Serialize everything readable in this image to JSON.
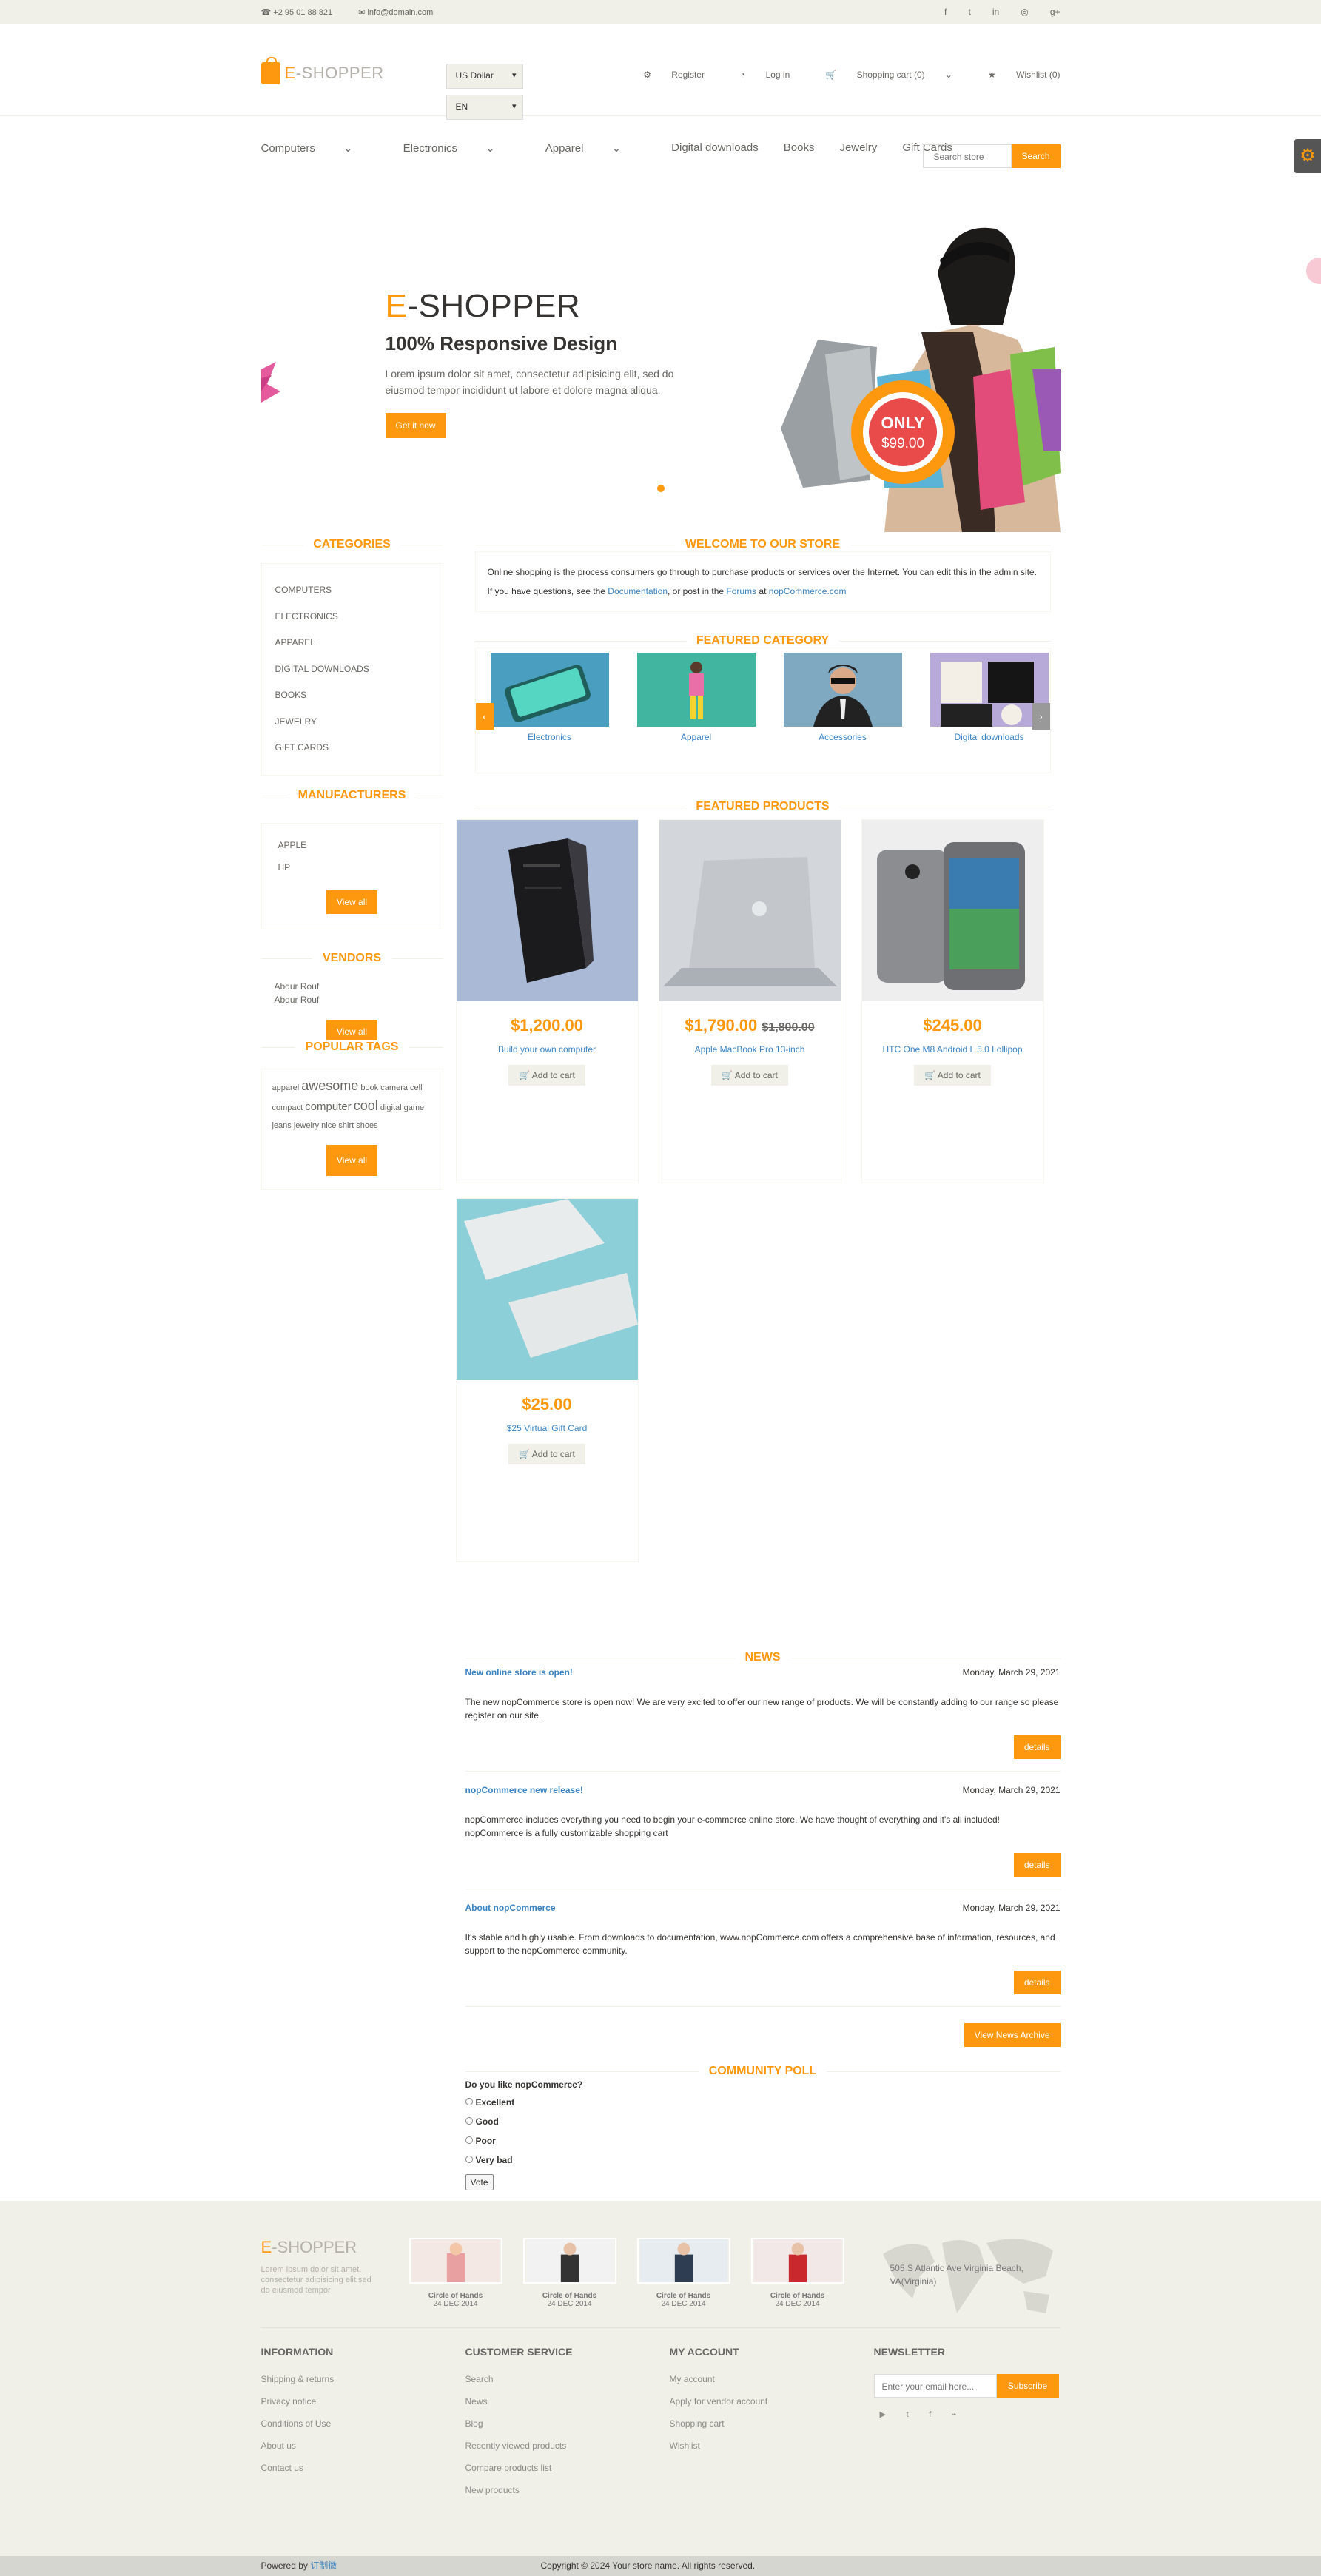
{
  "topbar": {
    "phone": "+2 95 01 88 821",
    "email": "info@domain.com"
  },
  "social_icons": [
    "facebook-icon",
    "twitter-icon",
    "linkedin-icon",
    "dribbble-icon",
    "google-plus-icon"
  ],
  "header": {
    "logo_e": "E",
    "logo_rest": "-SHOPPER",
    "currency": "US Dollar",
    "language": "EN",
    "register": "Register",
    "login": "Log in",
    "cart": "Shopping cart (0)",
    "wishlist": "Wishlist (0)"
  },
  "menu": {
    "items": [
      {
        "label": "Computers",
        "has_dropdown": true
      },
      {
        "label": "Electronics",
        "has_dropdown": true
      },
      {
        "label": "Apparel",
        "has_dropdown": true
      },
      {
        "label": "Digital downloads",
        "has_dropdown": false
      },
      {
        "label": "Books",
        "has_dropdown": false
      },
      {
        "label": "Jewelry",
        "has_dropdown": false
      },
      {
        "label": "Gift Cards",
        "has_dropdown": false
      }
    ],
    "search_placeholder": "Search store",
    "search_button": "Search"
  },
  "slider": {
    "title_e": "E",
    "title_rest": "-SHOPPER",
    "subtitle": "100% Responsive Design",
    "text": "Lorem ipsum dolor sit amet, consectetur adipisicing elit, sed do eiusmod tempor incididunt ut labore et dolore magna aliqua.",
    "button": "Get it now",
    "badge_top": "ONLY",
    "badge_price": "$99.00"
  },
  "sidebar": {
    "categories_title": "CATEGORIES",
    "categories": [
      "COMPUTERS",
      "ELECTRONICS",
      "APPAREL",
      "DIGITAL DOWNLOADS",
      "BOOKS",
      "JEWELRY",
      "GIFT CARDS"
    ],
    "manufacturers_title": "MANUFACTURERS",
    "manufacturers": [
      "APPLE",
      "HP"
    ],
    "view_all": "View all",
    "vendors_title": "VENDORS",
    "vendors": [
      "Abdur Rouf",
      "Abdur Rouf"
    ],
    "tags_title": "POPULAR TAGS",
    "tags": {
      "t1": "apparel",
      "t2": "awesome",
      "t3": "book",
      "t4": "camera",
      "t5": "cell",
      "t6": "compact",
      "t7": "computer",
      "t8": "cool",
      "t9": "digital",
      "t10": "game",
      "t11": "jeans",
      "t12": "jewelry",
      "t13": "nice",
      "t14": "shirt",
      "t15": "shoes"
    }
  },
  "welcome": {
    "title": "WELCOME TO OUR STORE",
    "p1": "Online shopping is the process consumers go through to purchase products or services over the Internet. You can edit this in the admin site.",
    "p2_a": "If you have questions, see the ",
    "p2_link1": "Documentation",
    "p2_b": ", or post in the ",
    "p2_link2": "Forums",
    "p2_c": " at ",
    "p2_link3": "nopCommerce.com"
  },
  "featured_category": {
    "title": "FEATURED CATEGORY",
    "items": [
      "Electronics",
      "Apparel",
      "Accessories",
      "Digital downloads"
    ]
  },
  "featured_products": {
    "title": "FEATURED PRODUCTS",
    "add_to_cart": "Add to cart",
    "items": [
      {
        "price": "$1,200.00",
        "old_price": "",
        "name": "Build your own computer"
      },
      {
        "price": "$1,790.00",
        "old_price": "$1,800.00",
        "name": "Apple MacBook Pro 13-inch"
      },
      {
        "price": "$245.00",
        "old_price": "",
        "name": "HTC One M8 Android L 5.0 Lollipop"
      },
      {
        "price": "$25.00",
        "old_price": "",
        "name": "$25 Virtual Gift Card"
      }
    ]
  },
  "news": {
    "title": "NEWS",
    "details": "details",
    "archive_button": "View News Archive",
    "items": [
      {
        "title": "New online store is open!",
        "date": "Monday, March 29, 2021",
        "body": "The new nopCommerce store is open now! We are very excited to offer our new range of products. We will be constantly adding to our range so please register on our site."
      },
      {
        "title": "nopCommerce new release!",
        "date": "Monday, March 29, 2021",
        "body": "nopCommerce includes everything you need to begin your e-commerce online store. We have thought of everything and it's all included! nopCommerce is a fully customizable shopping cart"
      },
      {
        "title": "About nopCommerce",
        "date": "Monday, March 29, 2021",
        "body": "It's stable and highly usable. From downloads to documentation, www.nopCommerce.com offers a comprehensive base of information, resources, and support to the nopCommerce community."
      }
    ]
  },
  "poll": {
    "title": "COMMUNITY POLL",
    "question": "Do you like nopCommerce?",
    "options": [
      "Excellent",
      "Good",
      "Poor",
      "Very bad"
    ],
    "vote": "Vote"
  },
  "footer": {
    "logo_e": "E",
    "logo_rest": "-SHOPPER",
    "tagline": "Lorem ipsum dolor sit amet, consectetur adipisicing elit,sed do eiusmod tempor",
    "videos": [
      {
        "caption": "Circle of Hands",
        "date": "24 DEC 2014"
      },
      {
        "caption": "Circle of Hands",
        "date": "24 DEC 2014"
      },
      {
        "caption": "Circle of Hands",
        "date": "24 DEC 2014"
      },
      {
        "caption": "Circle of Hands",
        "date": "24 DEC 2014"
      }
    ],
    "address": "505 S Atlantic Ave Virginia Beach, VA(Virginia)",
    "information_title": "INFORMATION",
    "information": [
      "Shipping & returns",
      "Privacy notice",
      "Conditions of Use",
      "About us",
      "Contact us"
    ],
    "customer_service_title": "CUSTOMER SERVICE",
    "customer_service": [
      "Search",
      "News",
      "Blog",
      "Recently viewed products",
      "Compare products list",
      "New products"
    ],
    "my_account_title": "MY ACCOUNT",
    "my_account": [
      "My account",
      "Apply for vendor account",
      "Shopping cart",
      "Wishlist"
    ],
    "newsletter_title": "NEWSLETTER",
    "newsletter_placeholder": "Enter your email here...",
    "subscribe": "Subscribe",
    "social_icons": [
      "youtube-icon",
      "twitter-icon",
      "facebook-icon",
      "rss-icon"
    ],
    "powered_by": "Powered by ",
    "powered_link": "订制微",
    "copyright": "Copyright © 2024 Your store name. All rights reserved."
  }
}
